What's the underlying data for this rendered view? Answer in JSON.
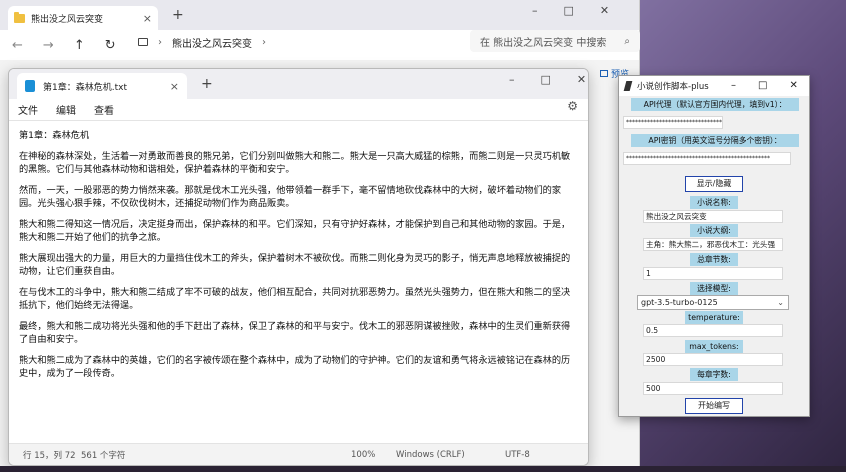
{
  "explorer": {
    "tab_title": "熊出没之风云突变",
    "tab_close": "×",
    "new_tab": "+",
    "address": "熊出没之风云突变",
    "search_placeholder": "在 熊出没之风云突变 中搜索",
    "nav": {
      "back": "←",
      "forward": "→",
      "up": "↑",
      "refresh": "↻"
    }
  },
  "notepad": {
    "tab_title": "第1章：森林危机.txt",
    "tab_close": "×",
    "new_tab": "+",
    "menu": [
      "文件",
      "编辑",
      "查看"
    ],
    "paragraphs": [
      "第1章：森林危机",
      "在神秘的森林深处，生活着一对勇敢而善良的熊兄弟，它们分别叫做熊大和熊二。熊大是一只高大威猛的棕熊，而熊二则是一只灵巧机敏的黑熊。它们与其他森林动物和谐相处，保护着森林的平衡和安宁。",
      "然而，一天，一股邪恶的势力悄然来袭。那就是伐木工光头强，他带领着一群手下，毫不留情地砍伐森林中的大树，破坏着动物们的家园。光头强心狠手辣，不仅砍伐树木，还捕捉动物们作为商品贩卖。",
      "熊大和熊二得知这一情况后，决定挺身而出，保护森林的和平。它们深知，只有守护好森林，才能保护到自己和其他动物的家园。于是，熊大和熊二开始了他们的抗争之旅。",
      "熊大展现出强大的力量，用巨大的力量挡住伐木工的斧头，保护着树木不被砍伐。而熊二则化身为灵巧的影子，悄无声息地释放被捕捉的动物，让它们重获自由。",
      "在与伐木工的斗争中，熊大和熊二结成了牢不可破的战友，他们相互配合，共同对抗邪恶势力。虽然光头强势力，但在熊大和熊二的坚决抵抗下，他们始终无法得逞。",
      "最终，熊大和熊二成功将光头强和他的手下赶出了森林，保卫了森林的和平与安宁。伐木工的邪恶阴谋被挫败，森林中的生灵们重新获得了自由和安宁。",
      "熊大和熊二成为了森林中的英雄，它们的名字被传颂在整个森林中，成为了动物们的守护神。它们的友谊和勇气将永远被铭记在森林的历史中，成为了一段传奇。"
    ],
    "status": {
      "position": "行 15，列 72",
      "chars": "561 个字符",
      "zoom": "100%",
      "eol": "Windows (CRLF)",
      "encoding": "UTF-8"
    }
  },
  "side_link": "预览",
  "panel": {
    "title": "小说创作脚本-plus",
    "api_proxy_label": "API代理（默认官方国内代理，填到v1）：",
    "api_proxy_value": "**********************************",
    "api_key_label": "API密钥（用英文逗号分隔多个密钥）：",
    "api_key_value": "************************************************",
    "toggle_button": "显示/隐藏",
    "novel_name_label": "小说名称:",
    "novel_name_value": "熊出没之风云突变",
    "outline_label": "小说大纲:",
    "outline_value": "主角：熊大熊二，邪恶伐木工：光头强",
    "chapters_label": "总章节数:",
    "chapters_value": "1",
    "model_label": "选择模型:",
    "model_value": "gpt-3.5-turbo-0125",
    "temperature_label": "temperature:",
    "temperature_value": "0.5",
    "max_tokens_label": "max_tokens:",
    "max_tokens_value": "2500",
    "words_label": "每章字数:",
    "words_value": "500",
    "start_button": "开始编写"
  },
  "window_controls": {
    "min": "–",
    "max": "□",
    "close": "✕"
  }
}
